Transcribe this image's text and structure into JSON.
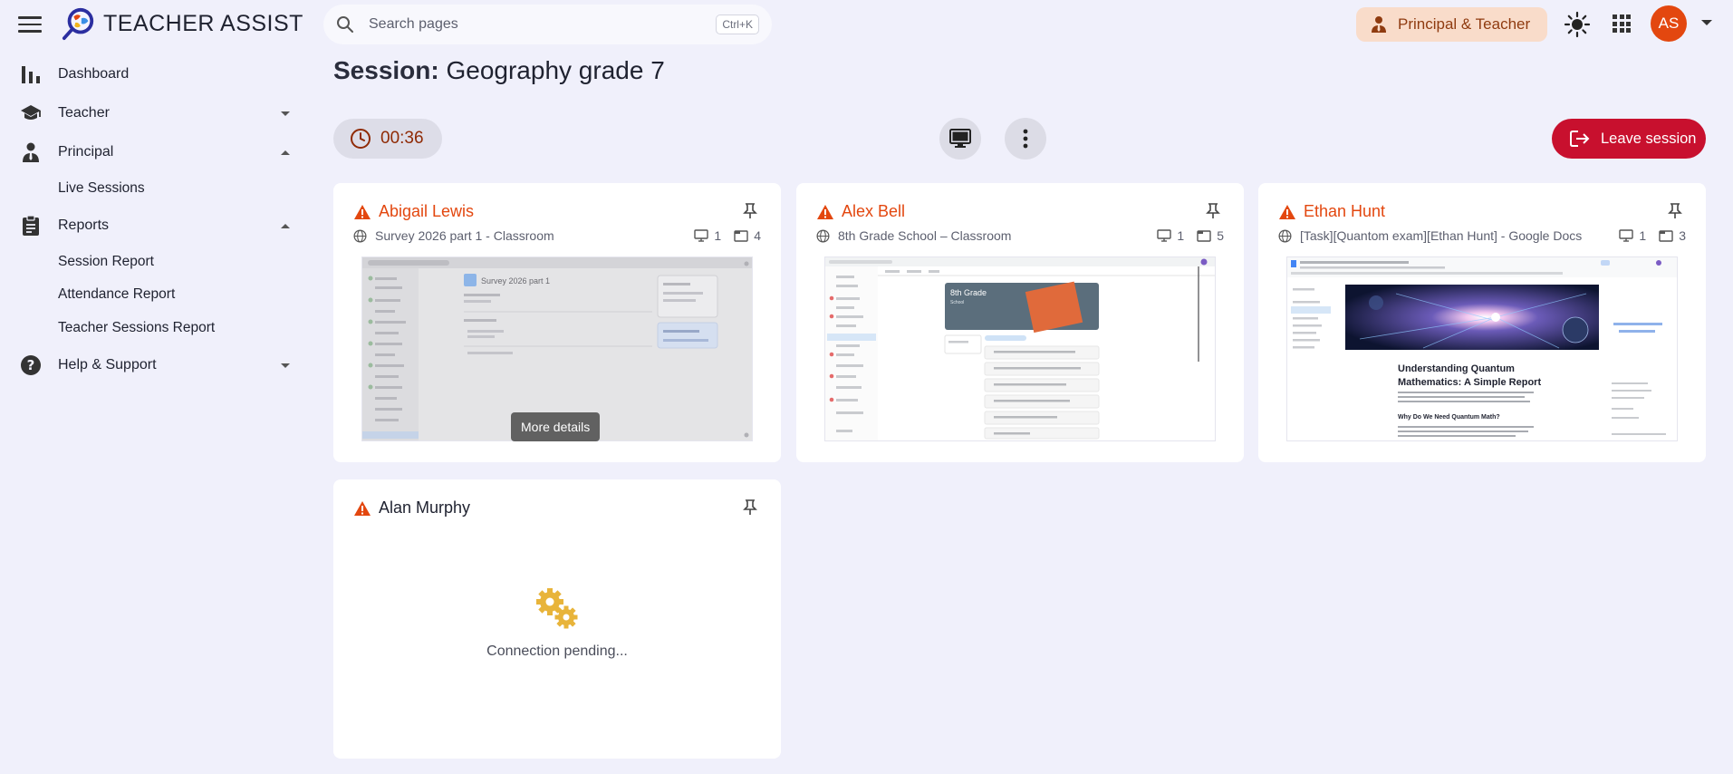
{
  "app": {
    "title": "TEACHER ASSIST"
  },
  "search": {
    "placeholder": "Search pages",
    "shortcut": "Ctrl+K"
  },
  "header": {
    "role": "Principal & Teacher",
    "avatar_initials": "AS"
  },
  "sidebar": {
    "dashboard": "Dashboard",
    "teacher": "Teacher",
    "principal": "Principal",
    "live_sessions": "Live Sessions",
    "reports": "Reports",
    "session_report": "Session Report",
    "attendance_report": "Attendance Report",
    "teacher_sessions_report": "Teacher Sessions Report",
    "help": "Help & Support"
  },
  "session": {
    "label": "Session:",
    "name": "Geography grade 7",
    "timer": "00:36",
    "leave_label": "Leave session"
  },
  "students": [
    {
      "name": "Abigail Lewis",
      "tab_title": "Survey 2026 part 1 - Classroom",
      "screens": "1",
      "tabs": "4"
    },
    {
      "name": "Alex Bell",
      "tab_title": "8th Grade School – Classroom",
      "screens": "1",
      "tabs": "5"
    },
    {
      "name": "Ethan Hunt",
      "tab_title": "[Task][Quantom exam][Ethan Hunt] - Google Docs",
      "screens": "1",
      "tabs": "3"
    },
    {
      "name": "Alan Murphy",
      "status": "Connection pending..."
    }
  ],
  "tooltip": {
    "more_details": "More details"
  },
  "thumbnails": {
    "abigail_doc_title": "Survey 2026 part 1",
    "alex_banner_title": "8th Grade",
    "alex_banner_sub": "School",
    "ethan_doc_title_1": "Understanding Quantum",
    "ethan_doc_title_2": "Mathematics: A Simple Report",
    "ethan_doc_heading": "Why Do We Need Quantum Math?"
  },
  "colors": {
    "accent": "#e3470f",
    "leave": "#c8102e",
    "background": "#f0f0fb",
    "role_chip": "#f9dcca"
  }
}
